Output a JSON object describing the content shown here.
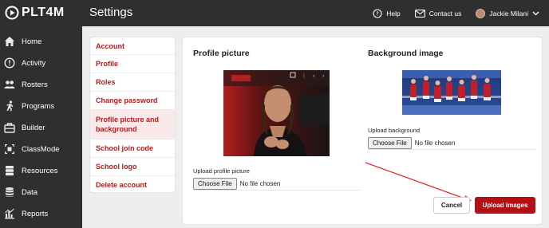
{
  "app": {
    "logo_text": "PLT4M",
    "page_title": "Settings"
  },
  "header": {
    "help_label": "Help",
    "contact_label": "Contact us",
    "user_name": "Jackie Milani"
  },
  "sidebar": {
    "items": [
      {
        "label": "Home",
        "icon": "home-icon"
      },
      {
        "label": "Activity",
        "icon": "activity-icon"
      },
      {
        "label": "Rosters",
        "icon": "rosters-icon"
      },
      {
        "label": "Programs",
        "icon": "programs-icon"
      },
      {
        "label": "Builder",
        "icon": "builder-icon"
      },
      {
        "label": "ClassMode",
        "icon": "classmode-icon"
      },
      {
        "label": "Resources",
        "icon": "resources-icon"
      },
      {
        "label": "Data",
        "icon": "data-icon"
      },
      {
        "label": "Reports",
        "icon": "reports-icon"
      }
    ]
  },
  "settings_menu": {
    "items": [
      {
        "label": "Account"
      },
      {
        "label": "Profile"
      },
      {
        "label": "Roles"
      },
      {
        "label": "Change password"
      },
      {
        "label": "Profile picture and background",
        "active": true
      },
      {
        "label": "School join code"
      },
      {
        "label": "School logo"
      },
      {
        "label": "Delete account"
      }
    ]
  },
  "profile_picture": {
    "title": "Profile picture",
    "upload_label": "Upload profile picture",
    "button_label": "Choose File",
    "file_status": "No file chosen"
  },
  "background_image": {
    "title": "Background image",
    "upload_label": "Upload background",
    "button_label": "Choose File",
    "file_status": "No file chosen"
  },
  "actions": {
    "cancel_label": "Cancel",
    "upload_label": "Upload images"
  },
  "colors": {
    "brand_red": "#b30f14",
    "menu_red": "#b21d1d",
    "dark_bg": "#2f2f2f",
    "arrow": "#e0302a"
  }
}
